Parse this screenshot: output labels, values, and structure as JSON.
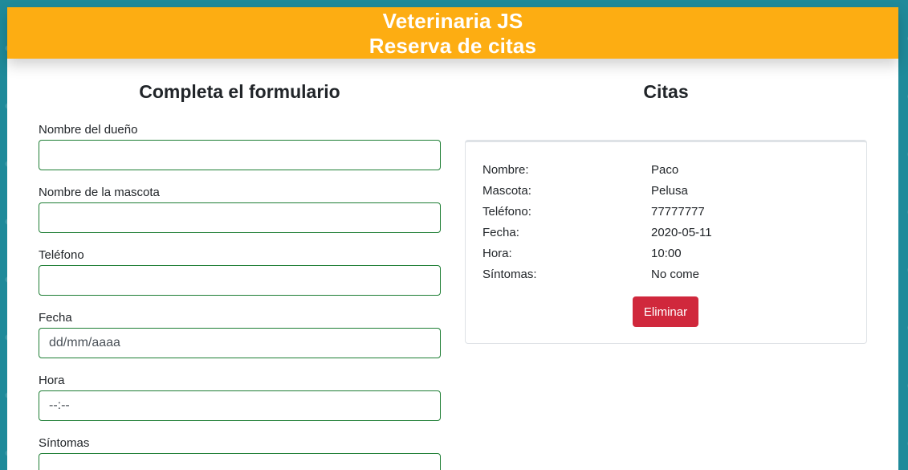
{
  "header": {
    "title": "Veterinaria JS",
    "subtitle": "Reserva de citas"
  },
  "form": {
    "heading": "Completa el formulario",
    "fields": [
      {
        "label": "Nombre del dueño",
        "value": "",
        "placeholder": ""
      },
      {
        "label": "Nombre de la mascota",
        "value": "",
        "placeholder": ""
      },
      {
        "label": "Teléfono",
        "value": "",
        "placeholder": ""
      },
      {
        "label": "Fecha",
        "value": "",
        "placeholder": "dd/mm/aaaa"
      },
      {
        "label": "Hora",
        "value": "",
        "placeholder": "--:--"
      },
      {
        "label": "Síntomas",
        "value": "",
        "placeholder": ""
      }
    ]
  },
  "appointments": {
    "heading": "Citas",
    "items": [
      {
        "rows": [
          {
            "key": "Nombre:",
            "value": "Paco"
          },
          {
            "key": "Mascota:",
            "value": "Pelusa"
          },
          {
            "key": "Teléfono:",
            "value": "77777777"
          },
          {
            "key": "Fecha:",
            "value": "2020-05-11"
          },
          {
            "key": "Hora:",
            "value": "10:00"
          },
          {
            "key": "Síntomas:",
            "value": "No come"
          }
        ],
        "delete_label": "Eliminar"
      }
    ]
  },
  "colors": {
    "header_bg": "#fdad12",
    "input_border": "#1e7e34",
    "delete_button": "#d0283c",
    "page_background": "#1f8a9a"
  }
}
